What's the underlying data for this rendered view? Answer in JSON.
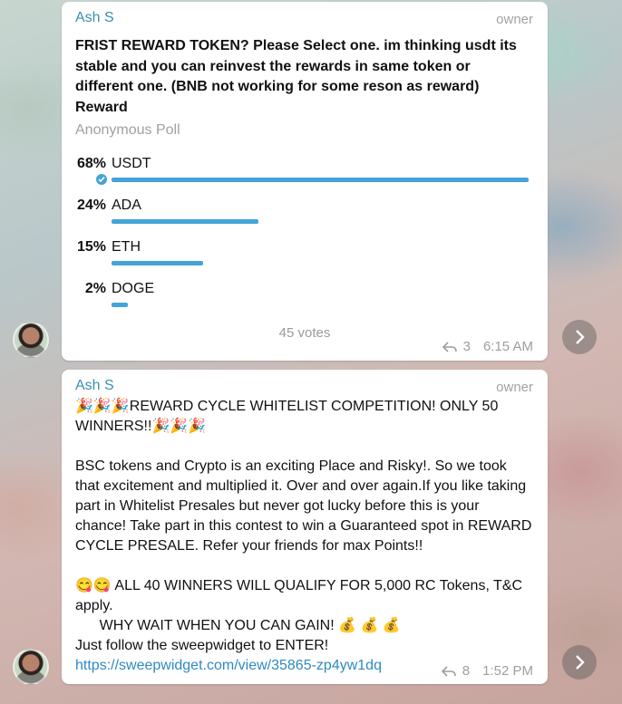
{
  "messages": [
    {
      "author": "Ash S",
      "role": "owner",
      "poll": {
        "question": "FRIST REWARD TOKEN? Please Select one. im thinking usdt its stable and you can reinvest the rewards in same token or different one.  (BNB not working for some reson as reward) Reward",
        "type": "Anonymous Poll",
        "options": [
          {
            "percent": "68%",
            "label": "USDT",
            "fraction": 0.68,
            "selected": true
          },
          {
            "percent": "24%",
            "label": "ADA",
            "fraction": 0.24,
            "selected": false
          },
          {
            "percent": "15%",
            "label": "ETH",
            "fraction": 0.15,
            "selected": false
          },
          {
            "percent": "2%",
            "label": "DOGE",
            "fraction": 0.02,
            "selected": false
          }
        ],
        "votes": "45 votes"
      },
      "replies": "3",
      "time": "6:15 AM"
    },
    {
      "author": "Ash S",
      "role": "owner",
      "line1_emoji": "🎉🎉🎉",
      "line1_text": "REWARD CYCLE WHITELIST COMPETITION! ONLY 50 WINNERS!!",
      "line1_emoji_end": "🎉🎉🎉",
      "paragraph2": "BSC tokens and Crypto is an exciting Place and Risky!. So we took that excitement and multiplied it. Over and over again.If you like taking part in Whitelist Presales but never got lucky before this is your chance! Take part in this contest to win a Guaranteed spot in REWARD CYCLE PRESALE. Refer your friends for max Points!!",
      "line3_emoji": "😋😋",
      "line3_text": " ALL 40 WINNERS WILL QUALIFY FOR 5,000 RC Tokens, T&C apply.",
      "line4_text": "      WHY WAIT WHEN YOU CAN GAIN! ",
      "line4_emoji": "💰 💰 💰",
      "line5_text": "Just follow the sweepwidget to ENTER!",
      "link": "https://sweepwidget.com/view/35865-zp4yw1dq",
      "replies": "8",
      "time": "1:52 PM"
    }
  ],
  "colors": {
    "accent": "#44a3d8",
    "author": "#3a8fb0",
    "link": "#2f89c2"
  },
  "icons": [
    "check-icon",
    "reply-icon",
    "chevron-right-icon",
    "avatar"
  ]
}
